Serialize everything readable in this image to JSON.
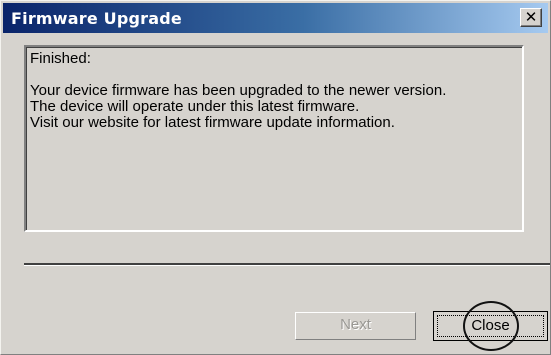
{
  "window": {
    "title": "Firmware Upgrade",
    "close_glyph": "✕"
  },
  "message": {
    "status": "Finished:",
    "lines": [
      "Your device firmware has been upgraded to the newer version.",
      "The device will operate under this latest firmware.",
      "Visit our website for latest firmware update information."
    ]
  },
  "buttons": {
    "next_label": "Next",
    "next_enabled": false,
    "close_label": "Close",
    "close_focused": true
  },
  "colors": {
    "title_gradient_start": "#0a246a",
    "title_gradient_end": "#a6caf0",
    "face": "#d6d3ce",
    "disabled_text": "#9a9894"
  }
}
